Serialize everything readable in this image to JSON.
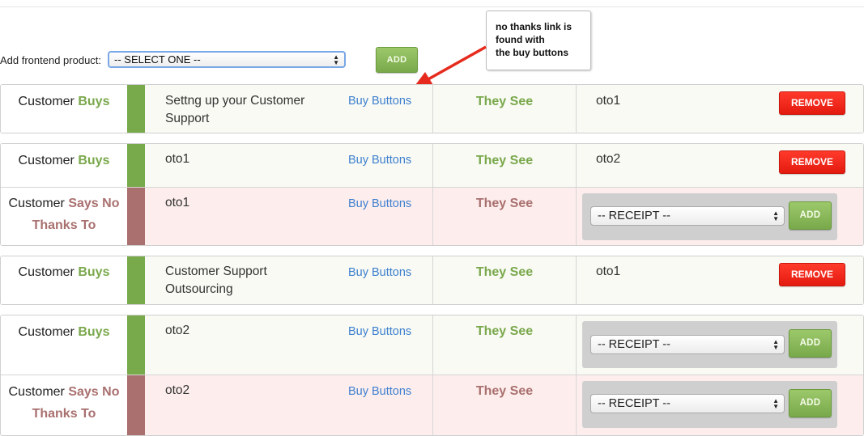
{
  "add_bar": {
    "label": "Add frontend product:",
    "select_value": "-- SELECT ONE --",
    "add_label": "ADD"
  },
  "callout": {
    "lines": [
      "no thanks link is",
      "found with",
      "the buy buttons"
    ]
  },
  "common": {
    "customer": "Customer",
    "buys": "Buys",
    "says_no": "Says No",
    "thanks_to": "Thanks To",
    "buy_buttons": "Buy Buttons",
    "they_see": "They See",
    "remove": "REMOVE",
    "receipt": "-- RECEIPT --",
    "add": "ADD"
  },
  "rows": [
    {
      "type": "buys",
      "product_line1": "Settng up your Customer",
      "product_line2": "Support",
      "result": "oto1"
    },
    {
      "type": "buys",
      "product_line1": "oto1",
      "product_line2": "",
      "result": "oto2"
    },
    {
      "type": "nothanks",
      "product_line1": "oto1",
      "product_line2": "",
      "result": ""
    },
    {
      "type": "buys",
      "product_line1": "Customer Support",
      "product_line2": "Outsourcing",
      "result": "oto1"
    },
    {
      "type": "buys",
      "product_line1": "oto2",
      "product_line2": "",
      "result": ""
    },
    {
      "type": "nothanks",
      "product_line1": "oto2",
      "product_line2": "",
      "result": ""
    }
  ],
  "colors": {
    "green_accent": "#78a94a",
    "mauve_accent": "#a9706f",
    "remove_red": "#e41b10",
    "link_blue": "#3e7fcf"
  }
}
